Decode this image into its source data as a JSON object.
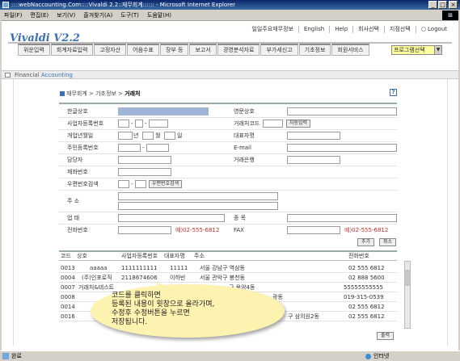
{
  "window": {
    "title": "::::webNaccounting.Com::::Vivaldi 2.2::재무회계:::::: - Microsoft Internet Explorer",
    "controls": [
      "_",
      "□",
      "×"
    ]
  },
  "menubar": [
    "파일(F)",
    "편집(E)",
    "보기(V)",
    "즐겨찾기(A)",
    "도구(T)",
    "도움말(H)"
  ],
  "app": {
    "logo": "Vivaldi  V2.2",
    "toplinks": [
      "일일주요재무정보",
      "English",
      "Help",
      "회사선택",
      "지점선택",
      "Logout"
    ],
    "nav": [
      "위운입력",
      "회계자료입력",
      "고정자산",
      "어음수표",
      "장부 등",
      "보고서",
      "경영분석자료",
      "부가세신고",
      "기초정보",
      "회원서비스"
    ],
    "program_select": "프로그램선택",
    "strip": {
      "prefix": "Financial",
      "highlight": "Accounting"
    },
    "breadcrumb": {
      "path": "재무회계 > 기초정보 > ",
      "current": "거래처"
    }
  },
  "form": {
    "company_name": {
      "label": "한글상호"
    },
    "eng_name": {
      "label": "영문상호"
    },
    "biz_no": {
      "label": "사업자등록번호"
    },
    "client_code": {
      "label": "거래처코드",
      "button": "자동입력"
    },
    "open_date": {
      "label": "개업년월일",
      "year": "년",
      "month": "월",
      "day": "일"
    },
    "ceo": {
      "label": "대표자명"
    },
    "resident_no": {
      "label": "주민등록번호"
    },
    "email": {
      "label": "E-mail"
    },
    "manager": {
      "label": "담당자"
    },
    "bank": {
      "label": "거래은행"
    },
    "corp_no": {
      "label": "제좌번호"
    },
    "postal": {
      "label": "우편번호검색",
      "button": "우편번호검색"
    },
    "address": {
      "label": "주 소"
    },
    "business": {
      "label": "업 태"
    },
    "item": {
      "label": "종 목"
    },
    "phone": {
      "label": "전화번호",
      "example": "예)02-555-6812"
    },
    "fax": {
      "label": "FAX",
      "example": "예)02-555-6812"
    }
  },
  "actions": {
    "add": "추가",
    "cancel": "취소",
    "print": "출력"
  },
  "table": {
    "headers": [
      "코드",
      "상호",
      "사업자등록번호",
      "대표자명",
      "주소",
      "전화번호"
    ],
    "rows": [
      [
        "0013",
        "aaaaa",
        "1111111111",
        "11111",
        "서울 강남구 역삼동",
        "02 555 6812"
      ],
      [
        "0004",
        "(주)인포로직",
        "2118674606",
        "이하빈",
        "서울 관악구 봉천동",
        "02 888 5600"
      ],
      [
        "0007",
        "거래처&테스트",
        "",
        "",
        "구 용암4동",
        "55555555555"
      ],
      [
        "0008",
        "",
        "",
        "",
        "광동",
        "019-315-0539"
      ],
      [
        "0014",
        "",
        "",
        "",
        "",
        "02 555 6812"
      ],
      [
        "0016",
        "",
        "",
        "",
        "구 삼의원2동",
        "02 555 6812"
      ]
    ]
  },
  "callout": {
    "lines": [
      "코드를 클릭하면",
      "등록된 내용이 윗창으로 올라가며,",
      "수정후 수정버튼을 누르면",
      "저장됩니다."
    ]
  },
  "statusbar": {
    "status": "완료",
    "zone": "인터넷"
  }
}
